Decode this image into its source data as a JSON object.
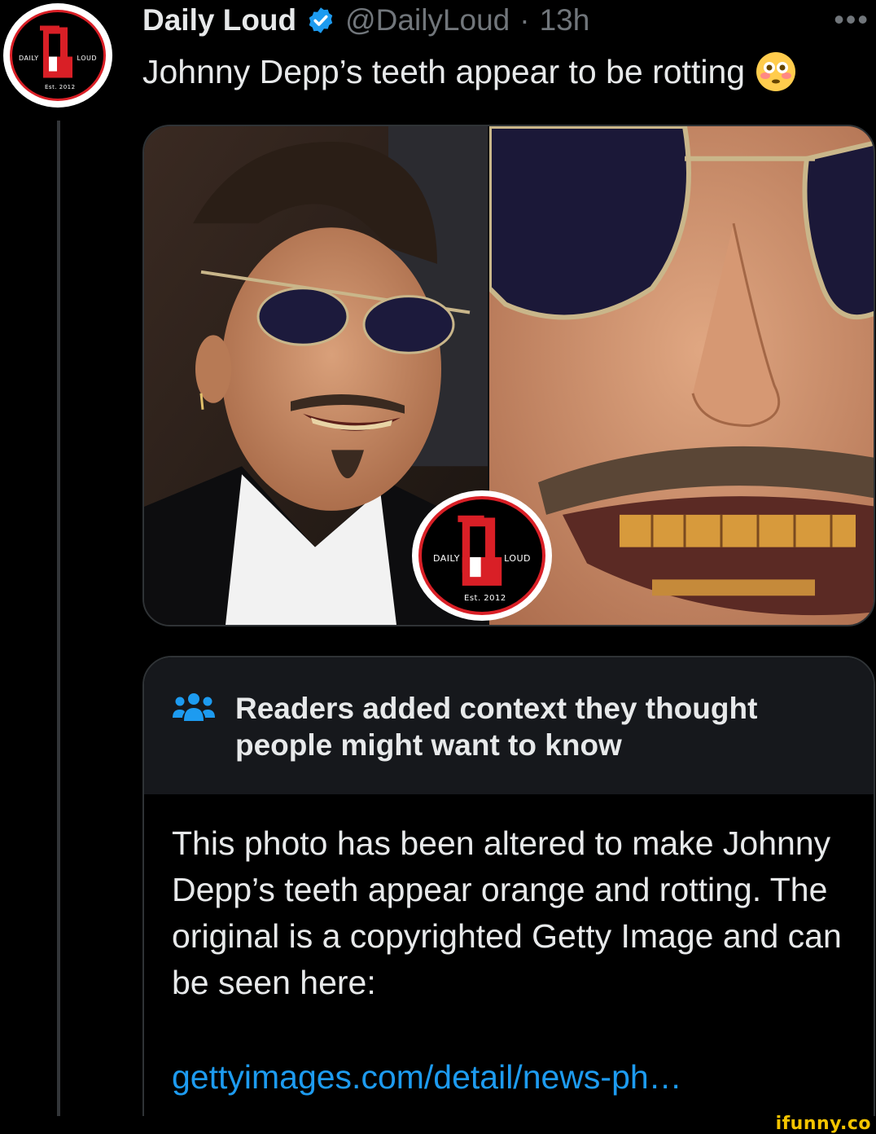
{
  "tweet": {
    "display_name": "Daily Loud",
    "handle": "@DailyLoud",
    "separator": "·",
    "time": "13h",
    "text": "Johnny Depp’s teeth appear to be rotting",
    "more_label": "•••"
  },
  "avatar": {
    "left_text": "DAILY",
    "right_text": "LOUD",
    "est_text": "Est. 2012"
  },
  "media": {
    "logo_left_text": "DAILY",
    "logo_right_text": "LOUD",
    "logo_est_text": "Est. 2012"
  },
  "community_note": {
    "title": "Readers added context they thought people might want to know",
    "body": "This photo has been altered to make Johnny Depp’s teeth appear orange and rotting. The original is a copyrighted Getty Image and can be seen here:",
    "link_text": "gettyimages.com/detail/news-ph…"
  },
  "watermark": {
    "text": "ifunny.co"
  },
  "colors": {
    "background": "#000000",
    "text": "#e7e9ea",
    "muted": "#71767b",
    "link": "#1d9bf0",
    "verified": "#1d9bf0",
    "brand_red": "#d91f26",
    "note_header_bg": "#16181c",
    "ifunny_yellow": "#f4c400"
  },
  "icons": {
    "verified": "verified-badge-icon",
    "more": "more-horizontal-icon",
    "note": "people-group-icon",
    "reaction": "flushed-face-emoji"
  }
}
